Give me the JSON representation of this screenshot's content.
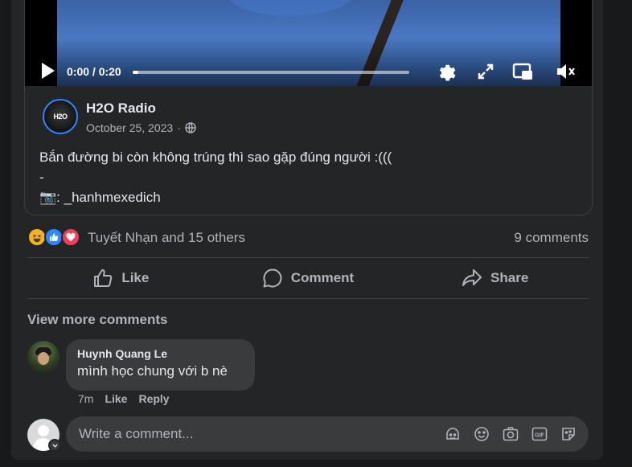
{
  "video": {
    "time": "0:00 / 0:20",
    "progress_fraction": 0.02
  },
  "shared_post": {
    "page_name": "H2O Radio",
    "avatar_text": "H2O",
    "date": "October 25, 2023",
    "date_separator": "·",
    "caption_lines": [
      "Bắn đường bi còn không trúng thì sao gặp đúng người :(((",
      "-",
      "📷: _hanhmexedich"
    ]
  },
  "reactions": {
    "icons": [
      "haha-reaction-icon",
      "like-reaction-icon",
      "love-reaction-icon"
    ],
    "summary": "Tuyết Nhạn and 15 others",
    "comments_count": "9 comments"
  },
  "actions": {
    "like": "Like",
    "comment": "Comment",
    "share": "Share"
  },
  "comments_section": {
    "view_more": "View more comments",
    "items": [
      {
        "author": "Huynh Quang Le",
        "text": "mình học chung với b nè",
        "time": "7m",
        "like_label": "Like",
        "reply_label": "Reply"
      }
    ]
  },
  "composer": {
    "placeholder": "Write a comment...",
    "icons": [
      "avatar-sticker-icon",
      "emoji-icon",
      "camera-icon",
      "gif-icon",
      "sticker-icon"
    ]
  },
  "colors": {
    "background": "#18191a",
    "card": "#242526",
    "bubble": "#3a3b3c",
    "text_primary": "#e4e6eb",
    "text_secondary": "#b0b3b8",
    "accent_blue": "#2d88ff"
  }
}
